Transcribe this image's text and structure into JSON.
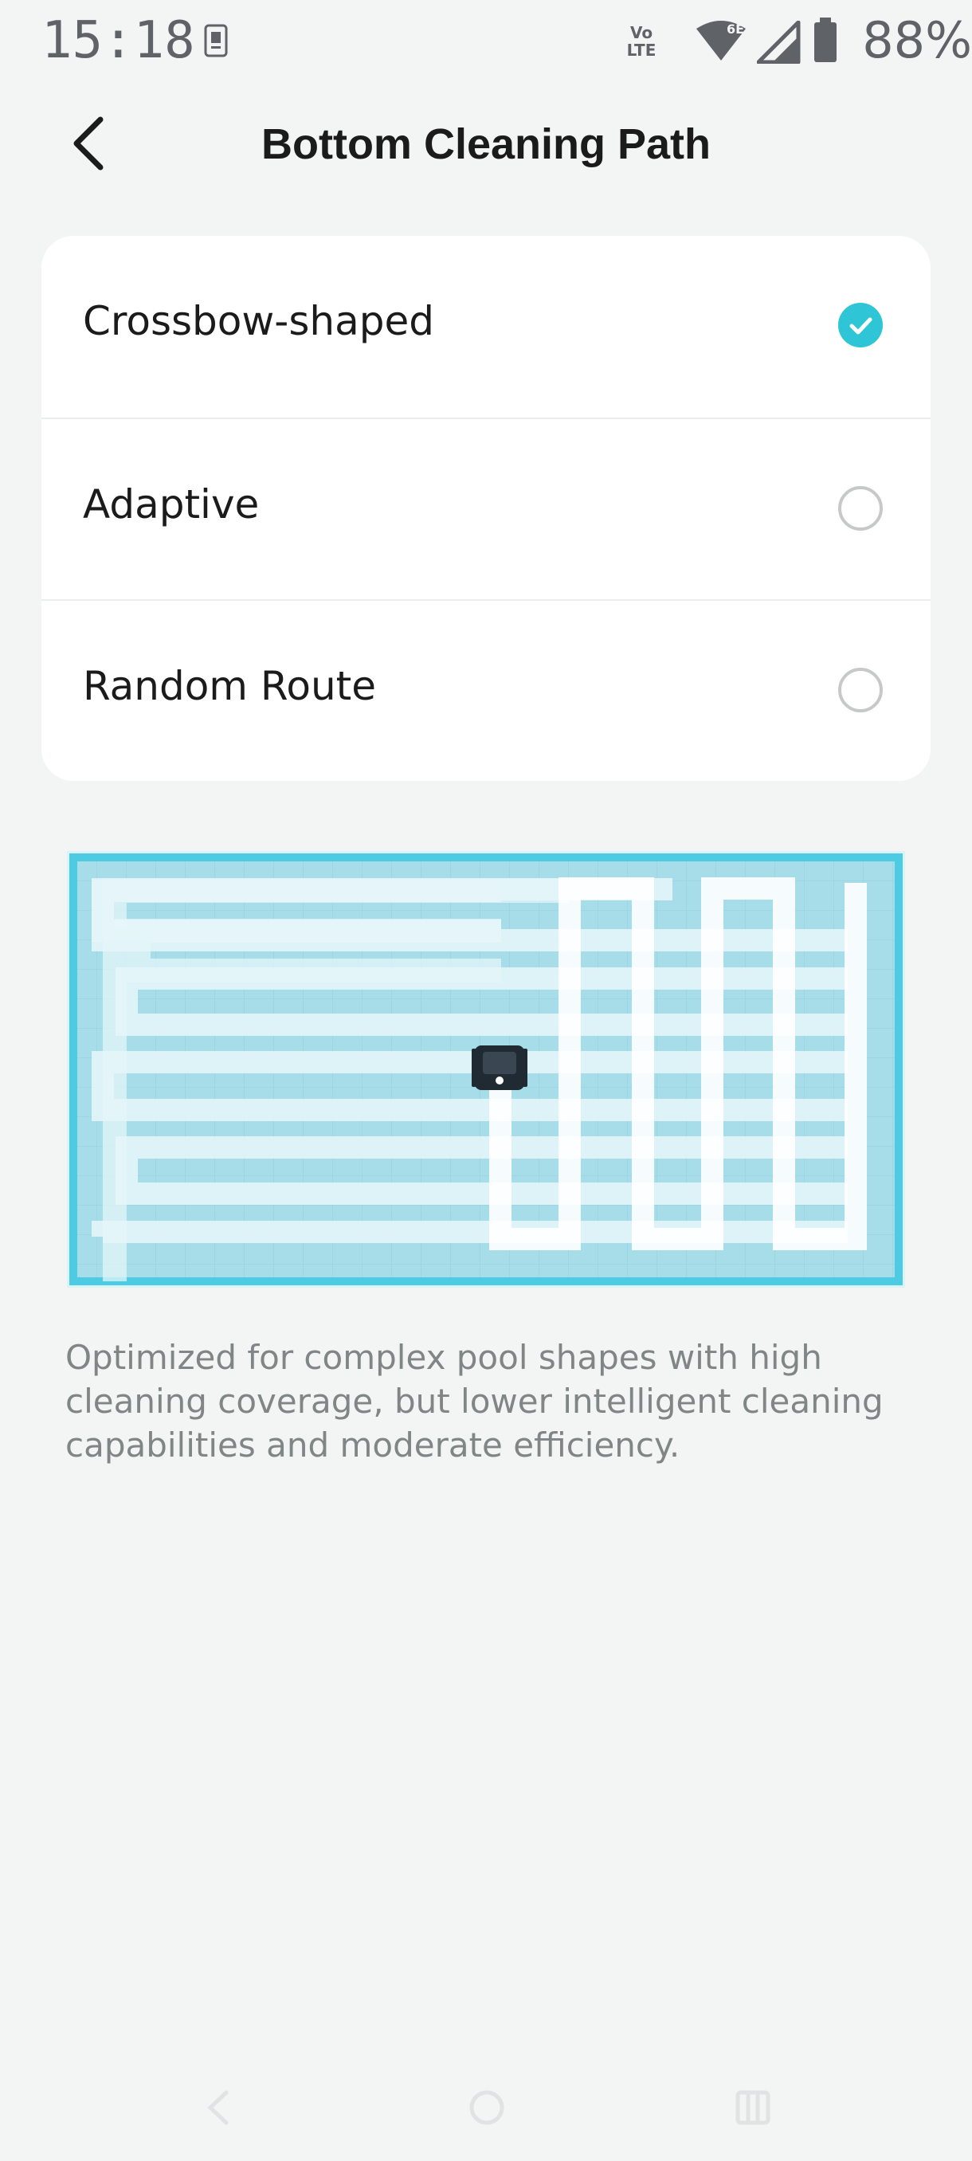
{
  "status_bar": {
    "time": "15:18",
    "volte_label": "Vo LTE",
    "wifi_badge": "6E",
    "battery_percent": "88%",
    "icons": [
      "sim-card-icon",
      "volte-icon",
      "wifi-icon",
      "signal-icon",
      "battery-icon"
    ]
  },
  "header": {
    "back_icon": "back-arrow-icon",
    "title": "Bottom Cleaning Path"
  },
  "options": [
    {
      "label": "Crossbow-shaped",
      "selected": true
    },
    {
      "label": "Adaptive",
      "selected": false
    },
    {
      "label": "Random Route",
      "selected": false
    }
  ],
  "illustration": {
    "name": "cleaning-path-diagram",
    "pool_color": "#a6dde8",
    "border_color": "#4ccbe2",
    "path_color": "#ffffff",
    "robot_icon": "robot-cleaner-icon"
  },
  "description": "Optimized for complex pool shapes with high cleaning coverage, but lower intelligent cleaning capabilities and moderate efficiency.",
  "nav_bar": {
    "icons": [
      "nav-back-icon",
      "nav-home-icon",
      "nav-recents-icon"
    ]
  },
  "colors": {
    "accent": "#2ec5d6",
    "background": "#f3f5f4"
  }
}
